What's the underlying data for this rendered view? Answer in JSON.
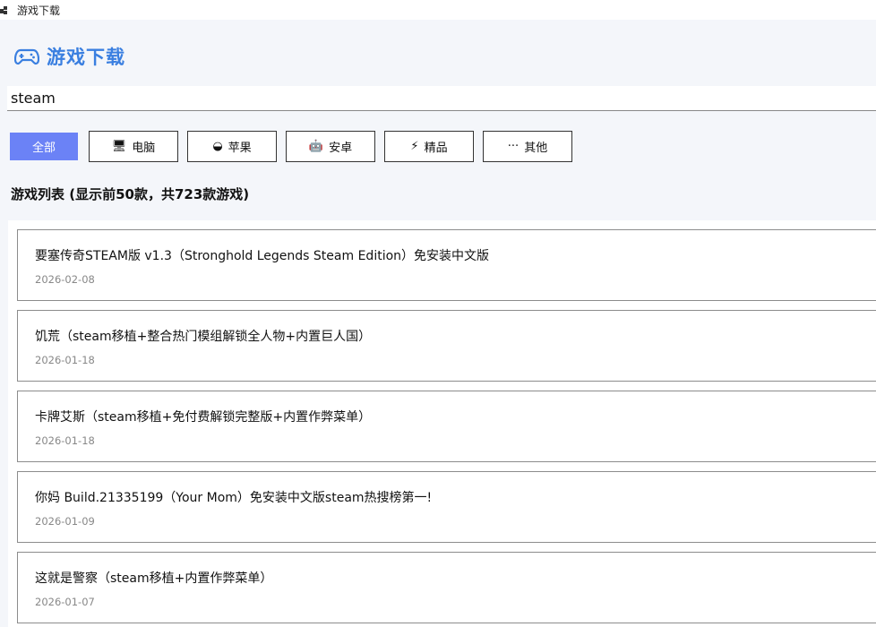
{
  "window": {
    "title": "游戏下载",
    "app_icon": "app-window-icon"
  },
  "header": {
    "title": "游戏下载",
    "icon": "gamepad-icon",
    "accent": "#3a7fe0"
  },
  "search": {
    "value": "steam"
  },
  "filters": [
    {
      "label": "全部",
      "icon": "",
      "active": true
    },
    {
      "label": "电脑",
      "icon": "computer-icon",
      "glyph": "🖥",
      "active": false
    },
    {
      "label": "苹果",
      "icon": "apple-icon",
      "glyph": "◒",
      "active": false
    },
    {
      "label": "安卓",
      "icon": "android-icon",
      "glyph": "🤖",
      "active": false
    },
    {
      "label": "精品",
      "icon": "bolt-icon",
      "glyph": "⚡",
      "active": false
    },
    {
      "label": "其他",
      "icon": "more-icon",
      "glyph": "···",
      "active": false
    }
  ],
  "colors": {
    "active_filter": "#6b82f6"
  },
  "list": {
    "title": "游戏列表 (显示前50款，共723款游戏)",
    "items": [
      {
        "name": "要塞传奇STEAM版 v1.3（Stronghold Legends Steam Edition）免安装中文版",
        "date": "2026-02-08"
      },
      {
        "name": "饥荒（steam移植+整合热门模组解锁全人物+内置巨人国）",
        "date": "2026-01-18"
      },
      {
        "name": "卡牌艾斯（steam移植+免付费解锁完整版+内置作弊菜单）",
        "date": "2026-01-18"
      },
      {
        "name": "你妈 Build.21335199（Your Mom）免安装中文版steam热搜榜第一!",
        "date": "2026-01-09"
      },
      {
        "name": "这就是警察（steam移植+内置作弊菜单）",
        "date": "2026-01-07"
      }
    ]
  }
}
